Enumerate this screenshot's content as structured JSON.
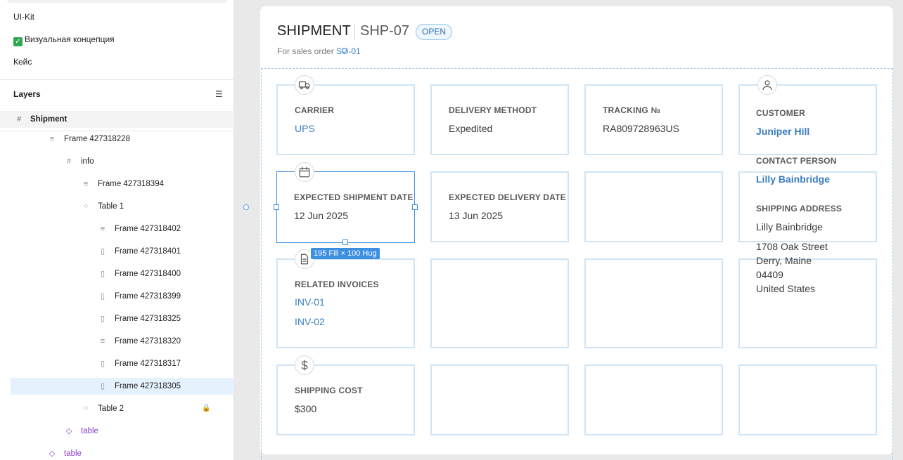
{
  "sidebar": {
    "pages": [
      {
        "label": "UI-Kit"
      },
      {
        "label": "Визуальная концепция",
        "check": "✓"
      },
      {
        "label": "Кейс"
      }
    ],
    "layers_title": "Layers",
    "layers": [
      {
        "label": "Shipment",
        "icon": "#"
      },
      {
        "label": "Frame 427318228",
        "icon": "≡"
      },
      {
        "label": "info",
        "icon": "#"
      },
      {
        "label": "Frame 427318394",
        "icon": "≡"
      },
      {
        "label": "Table 1",
        "icon": "⁘"
      },
      {
        "label": "Frame 427318402",
        "icon": "≡"
      },
      {
        "label": "Frame 427318401",
        "icon": "▯"
      },
      {
        "label": "Frame 427318400",
        "icon": "▯"
      },
      {
        "label": "Frame 427318399",
        "icon": "▯"
      },
      {
        "label": "Frame 427318325",
        "icon": "▯"
      },
      {
        "label": "Frame 427318320",
        "icon": "≡"
      },
      {
        "label": "Frame 427318317",
        "icon": "▯"
      },
      {
        "label": "Frame 427318305",
        "icon": "▯"
      },
      {
        "label": "Table 2",
        "icon": "⁘"
      },
      {
        "label": "table",
        "icon": "◇"
      },
      {
        "label": "table",
        "icon": "◇"
      }
    ]
  },
  "header": {
    "title": "SHIPMENT",
    "shipment_id": "SHP-07",
    "status": "OPEN",
    "subtitle_prefix": "For sales order",
    "sales_order": "SO-01"
  },
  "cells": {
    "carrier": {
      "label": "CARRIER",
      "value": "UPS"
    },
    "delivery_method": {
      "label": "DELIVERY METHODT",
      "value": "Expedited"
    },
    "tracking": {
      "label": "TRACKING №",
      "value": "RA809728963US"
    },
    "expected_shipment": {
      "label": "EXPECTED SHIPMENT DATE",
      "value": "12 Jun 2025"
    },
    "expected_delivery": {
      "label": "EXPECTED DELIVERY DATE",
      "value": "13 Jun 2025"
    },
    "related_invoices": {
      "label": "RELATED INVOICES",
      "values": [
        "INV-01",
        "INV-02"
      ]
    },
    "shipping_cost": {
      "label": "SHIPPING COST",
      "value": "$300"
    }
  },
  "customer": {
    "label": "CUSTOMER",
    "name": "Juniper Hill",
    "contact_label": "CONTACT PERSON",
    "contact_name": "Lilly Bainbridge",
    "address_label": "SHIPPING ADDRESS",
    "address_name": "Lilly Bainbridge",
    "address_lines": [
      "1708 Oak Street",
      "Derry, Maine",
      "04409",
      "United States"
    ]
  },
  "selection_badge": "195 Fill × 100 Hug",
  "colors": {
    "accent": "#3d8fe0",
    "link": "#3b7fc1",
    "cell_border": "#cfe5f7",
    "layer_selected": "#e5f1fd"
  }
}
